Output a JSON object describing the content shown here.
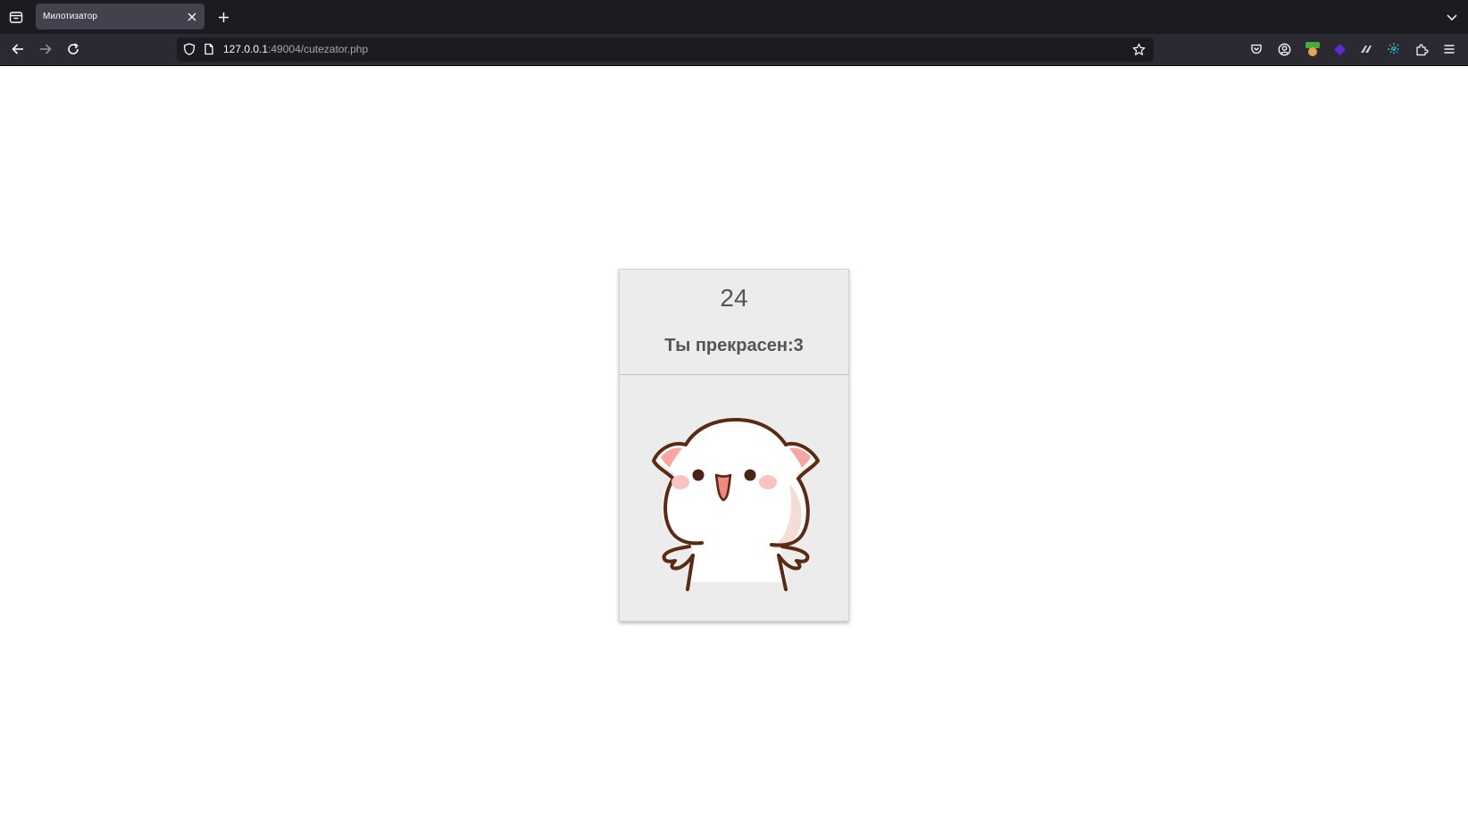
{
  "browser": {
    "tab": {
      "title": "Милотизатор"
    },
    "url": {
      "host": "127.0.0.1",
      "rest": ":49004/cutezator.php"
    }
  },
  "page": {
    "counter": "24",
    "message": "Ты прекрасен:3",
    "image_icon": "cute-cat-sticker-icon"
  },
  "colors": {
    "tabstrip_bg": "#1c1b22",
    "navbar_bg": "#2b2a33",
    "card_bg": "#ececec",
    "card_text": "#555555"
  }
}
